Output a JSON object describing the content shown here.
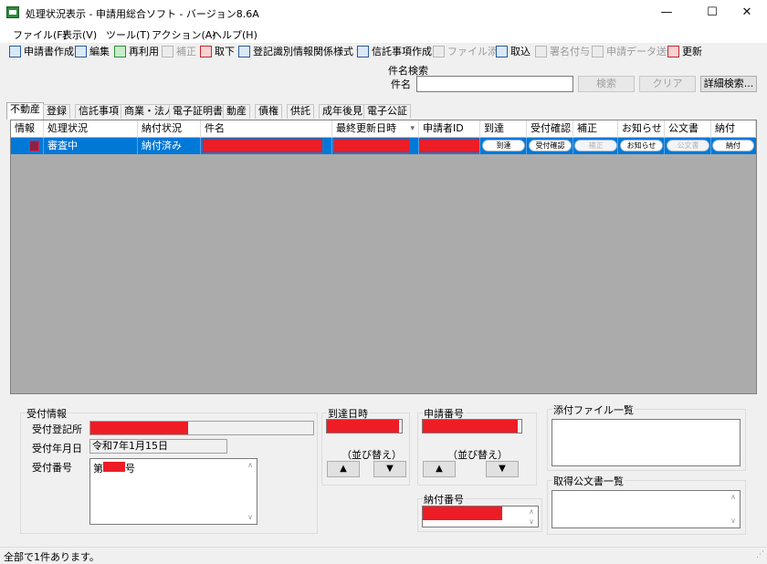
{
  "window": {
    "title": "処理状況表示 - 申請用総合ソフト - バージョン8.6A",
    "minimize": "—",
    "maximize": "☐",
    "close": "✕"
  },
  "menu": [
    "ファイル(F)",
    "表示(V)",
    "ツール(T)",
    "アクション(A)",
    "ヘルプ(H)"
  ],
  "toolbar": [
    {
      "label": "申請書作成",
      "icon": "form-icon",
      "enabled": true
    },
    {
      "label": "編集",
      "icon": "edit-icon",
      "enabled": true
    },
    {
      "label": "再利用",
      "icon": "reuse-icon",
      "enabled": true
    },
    {
      "label": "補正",
      "icon": "correct-icon",
      "enabled": false
    },
    {
      "label": "取下",
      "icon": "withdraw-icon",
      "enabled": true
    },
    {
      "label": "登記識別情報関係様式 ▾",
      "icon": "registry-icon",
      "enabled": true
    },
    {
      "label": "信託事項作成",
      "icon": "trust-icon",
      "enabled": true
    },
    {
      "label": "ファイル添付",
      "icon": "attach-icon",
      "enabled": false
    },
    {
      "label": "取込",
      "icon": "import-icon",
      "enabled": true
    },
    {
      "label": "署名付与",
      "icon": "sign-icon",
      "enabled": false
    },
    {
      "label": "申請データ送信",
      "icon": "send-icon",
      "enabled": false
    },
    {
      "label": "更新",
      "icon": "refresh-icon",
      "enabled": true
    }
  ],
  "search": {
    "group_label": "件名検索",
    "field_label": "件名",
    "value": "",
    "search_button": "検索",
    "clear_button": "クリア",
    "advanced_button": "詳細検索..."
  },
  "tabs": [
    "不動産",
    "登録",
    "信託事項",
    "商業・法人",
    "電子証明書",
    "動産",
    "債権",
    "供託",
    "成年後見",
    "電子公証"
  ],
  "grid": {
    "columns": [
      "情報",
      "処理状況",
      "納付状況",
      "件名",
      "最終更新日時",
      "申請者ID",
      "到達",
      "受付確認",
      "補正",
      "お知らせ",
      "公文書",
      "納付"
    ],
    "sort_indicator": "▾",
    "rows": [
      {
        "status": "審査中",
        "payment": "納付済み",
        "arrival": "到達",
        "receipt_confirm": "受付確認",
        "correction": "補正",
        "notice": "お知らせ",
        "document": "公文書",
        "pay": "納付"
      }
    ]
  },
  "receipt_info": {
    "group_label": "受付情報",
    "office_label": "受付登記所",
    "date_label": "受付年月日",
    "date_value": "令和7年1月15日",
    "number_label": "受付番号",
    "number_prefix": "第",
    "number_suffix": "号"
  },
  "arrival_datetime": {
    "group_label": "到達日時",
    "sort_label": "（並び替え）",
    "up": "▲",
    "down": "▼"
  },
  "application_number": {
    "group_label": "申請番号",
    "sort_label": "（並び替え）",
    "up": "▲",
    "down": "▼"
  },
  "payment_number": {
    "group_label": "納付番号"
  },
  "attachments": {
    "group_label": "添付ファイル一覧"
  },
  "official_documents": {
    "group_label": "取得公文書一覧"
  },
  "status_bar": "全部で1件あります。",
  "colors": {
    "selection": "#0078d7",
    "redaction": "#ee1c25",
    "grid_background": "#ababab"
  }
}
